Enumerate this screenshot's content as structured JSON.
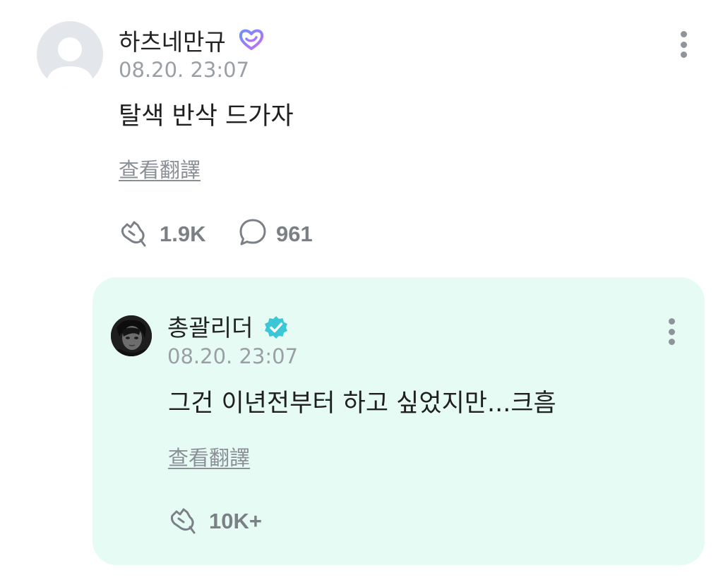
{
  "comment": {
    "author": "하츠네만규",
    "timestamp": "08.20. 23:07",
    "text": "탈색 반삭 드가자",
    "translate_label": "查看翻譯",
    "likes": "1.9K",
    "replies": "961"
  },
  "reply": {
    "author": "총괄리더",
    "timestamp": "08.20. 23:07",
    "text": "그건 이년전부터 하고 싶었지만...크흠",
    "translate_label": "查看翻譯",
    "likes": "10K+"
  },
  "colors": {
    "reply_background": "#e7fbf5",
    "verified_badge": "#3cc7d6",
    "fan_badge_gradient": [
      "#7a8cf5",
      "#c46cf2"
    ],
    "muted_text": "#9a9fa6"
  },
  "icons": {
    "fan_badge": "heart-badge-icon",
    "verified": "verified-check-icon",
    "like": "applause-hand-icon",
    "reply": "speech-bubble-icon",
    "more": "more-vertical-icon"
  }
}
